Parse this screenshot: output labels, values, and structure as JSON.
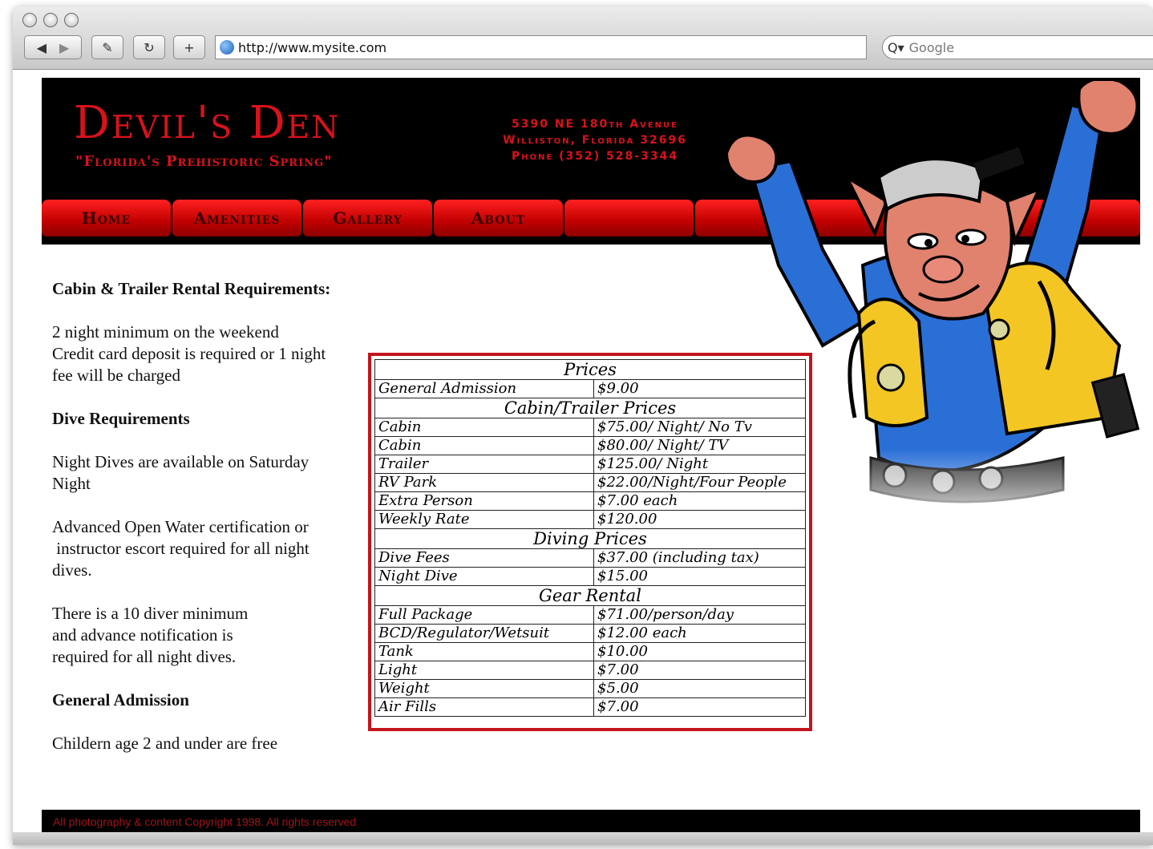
{
  "browser": {
    "url": "http://www.mysite.com",
    "search_placeholder": "Google",
    "nav_back_icon": "back-arrow-icon",
    "nav_forward_icon": "forward-arrow-icon"
  },
  "site": {
    "title": "Devil's Den",
    "tagline": "\"Florida's Prehistoric Spring\"",
    "address_line1": "5390 NE 180th Avenue",
    "address_line2": "Williston, Florida 32696",
    "address_line3": "Phone (352) 528-3344",
    "brand_color": "#d8121b"
  },
  "nav": {
    "items": [
      "Home",
      "Amenities",
      "Gallery",
      "About",
      "",
      ""
    ]
  },
  "left": {
    "heading1": "Cabin & Trailer Rental Requirements:",
    "p1_line1": "2 night minimum on the weekend",
    "p1_line2": "Credit  card deposit is required or 1 night",
    "p1_line3": "fee will be charged",
    "heading2": "Dive Requirements",
    "p2_line1": "Night Dives are available on Saturday",
    "p2_line2": "Night",
    "p3_line1": "Advanced Open Water certification or",
    "p3_line2": " instructor escort required for all night",
    "p3_line3": "dives.",
    "p4_line1": "There is a 10 diver minimum",
    "p4_line2": "and advance notification is",
    "p4_line3": "required for all night dives.",
    "heading3": "General Admission",
    "p5": "Childern age 2 and under are free"
  },
  "prices": {
    "sections": [
      {
        "title": "Prices",
        "rows": [
          [
            "General Admission",
            "$9.00"
          ]
        ]
      },
      {
        "title": "Cabin/Trailer Prices",
        "rows": [
          [
            "Cabin",
            "$75.00/ Night/ No Tv"
          ],
          [
            "Cabin",
            "$80.00/ Night/ TV"
          ],
          [
            "Trailer",
            "$125.00/ Night"
          ],
          [
            "RV Park",
            "$22.00/Night/Four People"
          ],
          [
            "Extra Person",
            "$7.00 each"
          ],
          [
            "Weekly Rate",
            "$120.00"
          ]
        ]
      },
      {
        "title": "Diving Prices",
        "rows": [
          [
            "Dive Fees",
            "$37.00 (including tax)"
          ],
          [
            "Night Dive",
            "$15.00"
          ]
        ]
      },
      {
        "title": "Gear Rental",
        "rows": [
          [
            "Full Package",
            "$71.00/person/day"
          ],
          [
            "BCD/Regulator/Wetsuit",
            "$12.00 each"
          ],
          [
            "Tank",
            "$10.00"
          ],
          [
            "Light",
            "$7.00"
          ],
          [
            "Weight",
            "$5.00"
          ],
          [
            "Air Fills",
            "$7.00"
          ]
        ]
      }
    ]
  },
  "footer": {
    "text": "All photography & content Copyright 1998.  All rights reserved"
  }
}
